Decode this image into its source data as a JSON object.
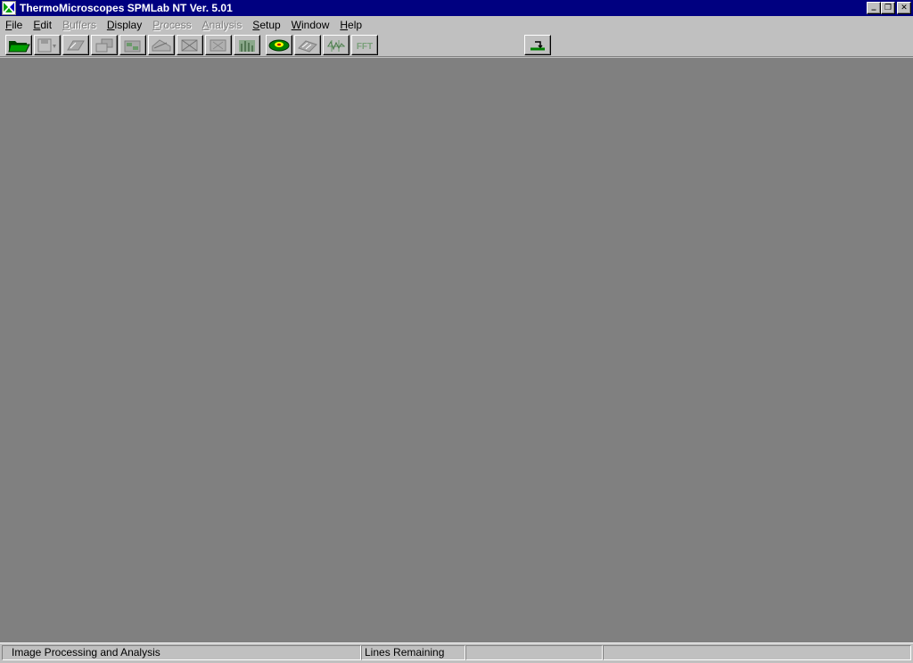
{
  "window": {
    "title": "ThermoMicroscopes SPMLab NT Ver. 5.01",
    "icon": "spmlab-app-icon",
    "controls": {
      "minimize_glyph": "_",
      "restore_glyph": "❐",
      "close_glyph": "✕"
    }
  },
  "menubar": {
    "items": [
      {
        "name": "file",
        "mnemonic": "F",
        "rest": "ile",
        "enabled": true
      },
      {
        "name": "edit",
        "mnemonic": "E",
        "rest": "dit",
        "enabled": true
      },
      {
        "name": "buffers",
        "mnemonic": "B",
        "rest": "uffers",
        "enabled": false
      },
      {
        "name": "display",
        "mnemonic": "D",
        "rest": "isplay",
        "enabled": true
      },
      {
        "name": "process",
        "mnemonic": "P",
        "rest": "rocess",
        "enabled": false
      },
      {
        "name": "analysis",
        "mnemonic": "A",
        "rest": "nalysis",
        "enabled": false
      },
      {
        "name": "setup",
        "mnemonic": "S",
        "rest": "etup",
        "enabled": true
      },
      {
        "name": "window",
        "mnemonic": "W",
        "rest": "indow",
        "enabled": true
      },
      {
        "name": "help",
        "mnemonic": "H",
        "rest": "elp",
        "enabled": true
      }
    ]
  },
  "toolbar": {
    "buttons": [
      {
        "icon": "open-folder-icon",
        "enabled": true
      },
      {
        "icon": "save-icon",
        "enabled": false
      },
      {
        "icon": "plane-fit-icon",
        "enabled": false
      },
      {
        "icon": "copy-buffer-icon",
        "enabled": false
      },
      {
        "icon": "filter-icon",
        "enabled": false
      },
      {
        "icon": "line-profile-icon",
        "enabled": false
      },
      {
        "icon": "cross-section-icon",
        "enabled": false
      },
      {
        "icon": "bearing-icon",
        "enabled": false
      },
      {
        "icon": "histogram-icon",
        "enabled": false
      },
      {
        "icon": "3d-view-icon",
        "enabled": true
      },
      {
        "icon": "grain-analysis-icon",
        "enabled": false
      },
      {
        "icon": "spectrum-icon",
        "enabled": false
      },
      {
        "icon": "fft-icon",
        "enabled": false,
        "label": "FFT"
      },
      {
        "icon": "microscope-mode-icon",
        "enabled": true
      }
    ]
  },
  "statusbar": {
    "mode_text": "Image Processing and Analysis",
    "lines_text": "Lines Remaining",
    "pane3_text": "",
    "pane4_text": ""
  },
  "colors": {
    "titlebar": "#000080",
    "chrome": "#c0c0c0",
    "workspace": "#808080",
    "icon_green": "#008000"
  }
}
